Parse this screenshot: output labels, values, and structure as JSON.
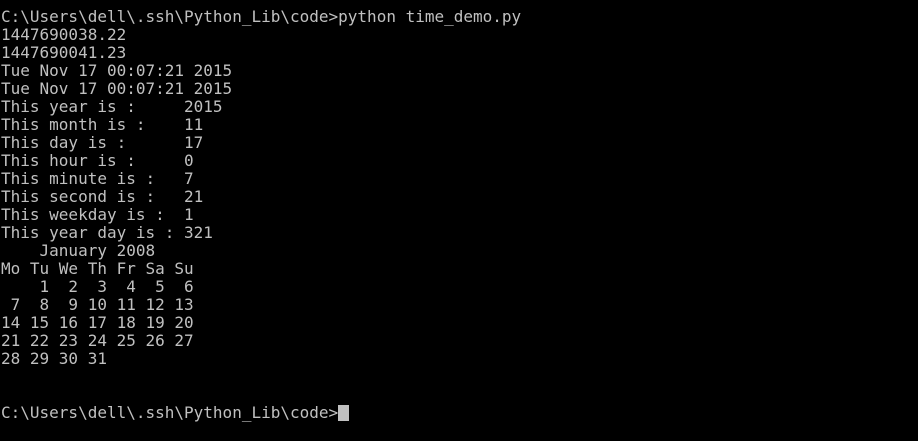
{
  "console": {
    "command_prompt": "C:\\Users\\dell\\.ssh\\Python_Lib\\code>",
    "command": "python time_demo.py",
    "output_lines": [
      "1447690038.22",
      "1447690041.23",
      "Tue Nov 17 00:07:21 2015",
      "Tue Nov 17 00:07:21 2015",
      "This year is :     2015",
      "This month is :    11",
      "This day is :      17",
      "This hour is :     0",
      "This minute is :   7",
      "This second is :   21",
      "This weekday is :  1",
      "This year day is : 321"
    ],
    "calendar": {
      "title": "    January 2008",
      "header": "Mo Tu We Th Fr Sa Su",
      "weeks": [
        "    1  2  3  4  5  6",
        " 7  8  9 10 11 12 13",
        "14 15 16 17 18 19 20",
        "21 22 23 24 25 26 27",
        "28 29 30 31"
      ]
    },
    "final_prompt": "C:\\Users\\dell\\.ssh\\Python_Lib\\code>"
  },
  "colors": {
    "background": "#000000",
    "text": "#c0c0c0"
  }
}
